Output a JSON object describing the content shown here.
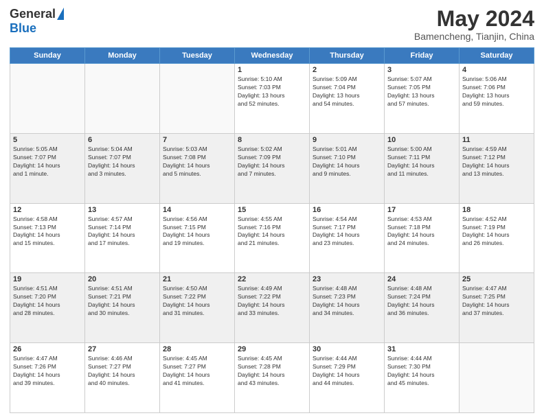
{
  "header": {
    "logo_general": "General",
    "logo_blue": "Blue",
    "month_title": "May 2024",
    "location": "Bamencheng, Tianjin, China"
  },
  "days_of_week": [
    "Sunday",
    "Monday",
    "Tuesday",
    "Wednesday",
    "Thursday",
    "Friday",
    "Saturday"
  ],
  "weeks": [
    [
      {
        "day": "",
        "info": ""
      },
      {
        "day": "",
        "info": ""
      },
      {
        "day": "",
        "info": ""
      },
      {
        "day": "1",
        "info": "Sunrise: 5:10 AM\nSunset: 7:03 PM\nDaylight: 13 hours\nand 52 minutes."
      },
      {
        "day": "2",
        "info": "Sunrise: 5:09 AM\nSunset: 7:04 PM\nDaylight: 13 hours\nand 54 minutes."
      },
      {
        "day": "3",
        "info": "Sunrise: 5:07 AM\nSunset: 7:05 PM\nDaylight: 13 hours\nand 57 minutes."
      },
      {
        "day": "4",
        "info": "Sunrise: 5:06 AM\nSunset: 7:06 PM\nDaylight: 13 hours\nand 59 minutes."
      }
    ],
    [
      {
        "day": "5",
        "info": "Sunrise: 5:05 AM\nSunset: 7:07 PM\nDaylight: 14 hours\nand 1 minute."
      },
      {
        "day": "6",
        "info": "Sunrise: 5:04 AM\nSunset: 7:07 PM\nDaylight: 14 hours\nand 3 minutes."
      },
      {
        "day": "7",
        "info": "Sunrise: 5:03 AM\nSunset: 7:08 PM\nDaylight: 14 hours\nand 5 minutes."
      },
      {
        "day": "8",
        "info": "Sunrise: 5:02 AM\nSunset: 7:09 PM\nDaylight: 14 hours\nand 7 minutes."
      },
      {
        "day": "9",
        "info": "Sunrise: 5:01 AM\nSunset: 7:10 PM\nDaylight: 14 hours\nand 9 minutes."
      },
      {
        "day": "10",
        "info": "Sunrise: 5:00 AM\nSunset: 7:11 PM\nDaylight: 14 hours\nand 11 minutes."
      },
      {
        "day": "11",
        "info": "Sunrise: 4:59 AM\nSunset: 7:12 PM\nDaylight: 14 hours\nand 13 minutes."
      }
    ],
    [
      {
        "day": "12",
        "info": "Sunrise: 4:58 AM\nSunset: 7:13 PM\nDaylight: 14 hours\nand 15 minutes."
      },
      {
        "day": "13",
        "info": "Sunrise: 4:57 AM\nSunset: 7:14 PM\nDaylight: 14 hours\nand 17 minutes."
      },
      {
        "day": "14",
        "info": "Sunrise: 4:56 AM\nSunset: 7:15 PM\nDaylight: 14 hours\nand 19 minutes."
      },
      {
        "day": "15",
        "info": "Sunrise: 4:55 AM\nSunset: 7:16 PM\nDaylight: 14 hours\nand 21 minutes."
      },
      {
        "day": "16",
        "info": "Sunrise: 4:54 AM\nSunset: 7:17 PM\nDaylight: 14 hours\nand 23 minutes."
      },
      {
        "day": "17",
        "info": "Sunrise: 4:53 AM\nSunset: 7:18 PM\nDaylight: 14 hours\nand 24 minutes."
      },
      {
        "day": "18",
        "info": "Sunrise: 4:52 AM\nSunset: 7:19 PM\nDaylight: 14 hours\nand 26 minutes."
      }
    ],
    [
      {
        "day": "19",
        "info": "Sunrise: 4:51 AM\nSunset: 7:20 PM\nDaylight: 14 hours\nand 28 minutes."
      },
      {
        "day": "20",
        "info": "Sunrise: 4:51 AM\nSunset: 7:21 PM\nDaylight: 14 hours\nand 30 minutes."
      },
      {
        "day": "21",
        "info": "Sunrise: 4:50 AM\nSunset: 7:22 PM\nDaylight: 14 hours\nand 31 minutes."
      },
      {
        "day": "22",
        "info": "Sunrise: 4:49 AM\nSunset: 7:22 PM\nDaylight: 14 hours\nand 33 minutes."
      },
      {
        "day": "23",
        "info": "Sunrise: 4:48 AM\nSunset: 7:23 PM\nDaylight: 14 hours\nand 34 minutes."
      },
      {
        "day": "24",
        "info": "Sunrise: 4:48 AM\nSunset: 7:24 PM\nDaylight: 14 hours\nand 36 minutes."
      },
      {
        "day": "25",
        "info": "Sunrise: 4:47 AM\nSunset: 7:25 PM\nDaylight: 14 hours\nand 37 minutes."
      }
    ],
    [
      {
        "day": "26",
        "info": "Sunrise: 4:47 AM\nSunset: 7:26 PM\nDaylight: 14 hours\nand 39 minutes."
      },
      {
        "day": "27",
        "info": "Sunrise: 4:46 AM\nSunset: 7:27 PM\nDaylight: 14 hours\nand 40 minutes."
      },
      {
        "day": "28",
        "info": "Sunrise: 4:45 AM\nSunset: 7:27 PM\nDaylight: 14 hours\nand 41 minutes."
      },
      {
        "day": "29",
        "info": "Sunrise: 4:45 AM\nSunset: 7:28 PM\nDaylight: 14 hours\nand 43 minutes."
      },
      {
        "day": "30",
        "info": "Sunrise: 4:44 AM\nSunset: 7:29 PM\nDaylight: 14 hours\nand 44 minutes."
      },
      {
        "day": "31",
        "info": "Sunrise: 4:44 AM\nSunset: 7:30 PM\nDaylight: 14 hours\nand 45 minutes."
      },
      {
        "day": "",
        "info": ""
      }
    ]
  ]
}
